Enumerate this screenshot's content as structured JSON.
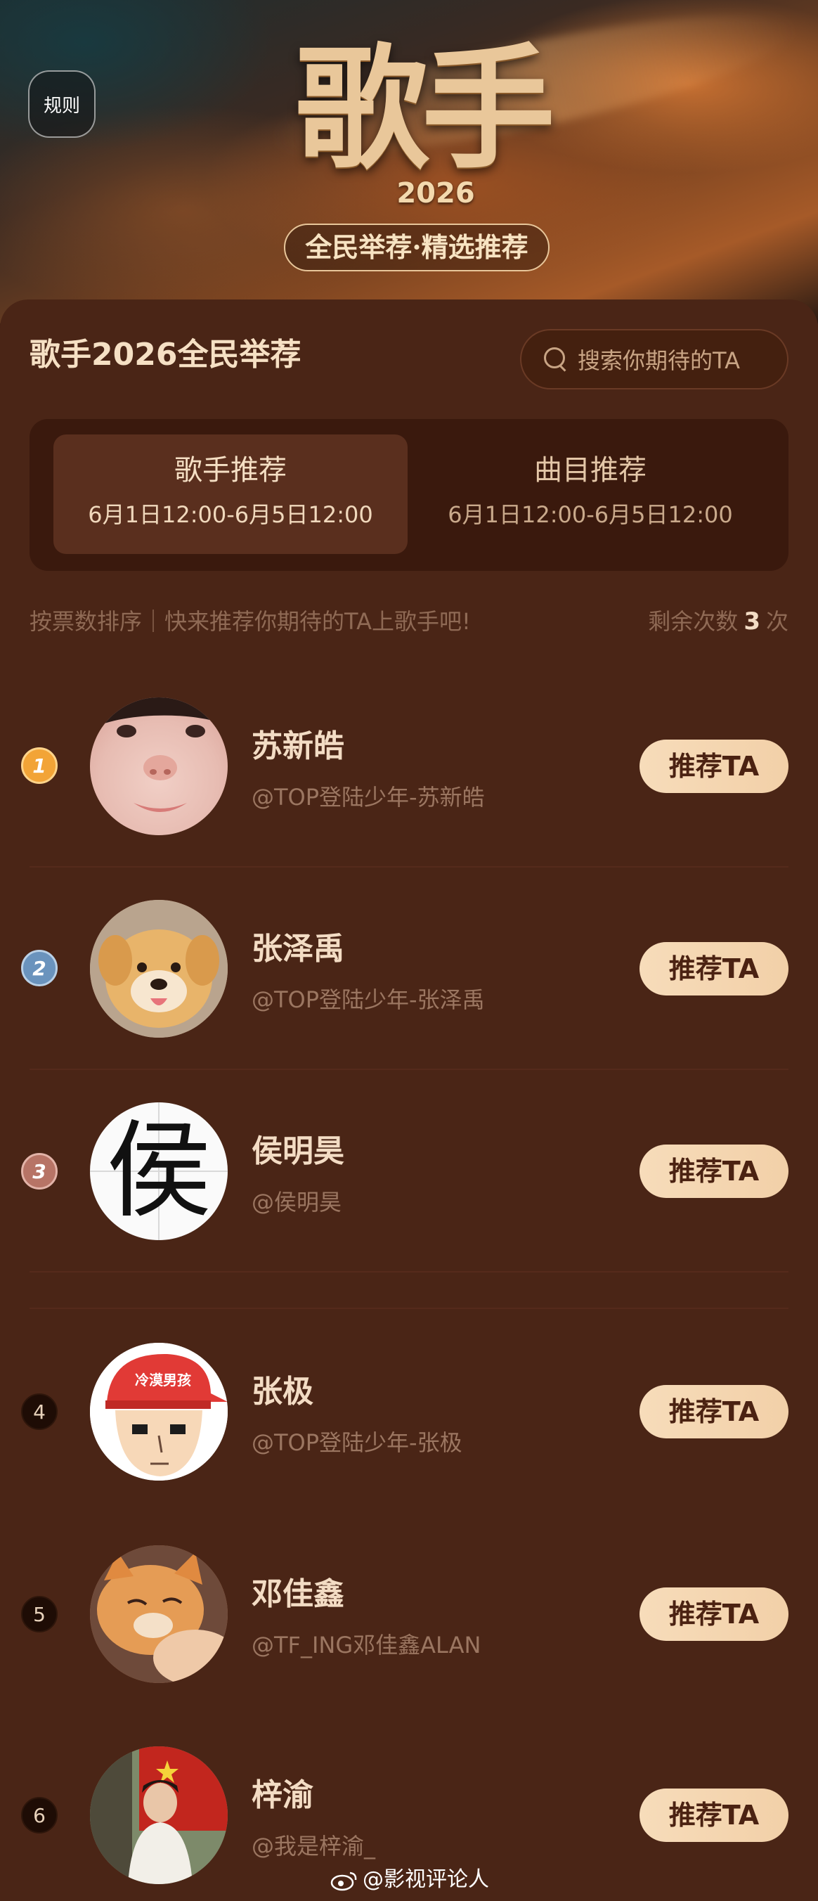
{
  "header": {
    "rules_label": "规则",
    "logo_text": "歌手",
    "logo_year": "2026",
    "logo_subtitle": "全民举荐·精选推荐"
  },
  "panel": {
    "title": "歌手2026全民举荐",
    "search_placeholder": "搜索你期待的TA"
  },
  "tabs": [
    {
      "label": "歌手推荐",
      "time": "6月1日12:00-6月5日12:00",
      "active": true
    },
    {
      "label": "曲目推荐",
      "time": "6月1日12:00-6月5日12:00",
      "active": false
    }
  ],
  "hint": "按票数排序｜快来推荐你期待的TA上歌手吧!",
  "remaining": {
    "prefix": "剩余次数",
    "count": "3",
    "suffix": "次"
  },
  "button_label": "推荐TA",
  "entries": [
    {
      "rank": "1",
      "name": "苏新皓",
      "handle": "@TOP登陆少年-苏新皓",
      "avatar": "face-closeup"
    },
    {
      "rank": "2",
      "name": "张泽禹",
      "handle": "@TOP登陆少年-张泽禹",
      "avatar": "puppy"
    },
    {
      "rank": "3",
      "name": "侯明昊",
      "handle": "@侯明昊",
      "avatar": "calligraphy-character",
      "avatar_text": "侯"
    },
    {
      "rank": "4",
      "name": "张极",
      "handle": "@TOP登陆少年-张极",
      "avatar": "cartoon-boy",
      "avatar_text": "冷漠男孩"
    },
    {
      "rank": "5",
      "name": "邓佳鑫",
      "handle": "@TF_ING邓佳鑫ALAN",
      "avatar": "cat"
    },
    {
      "rank": "6",
      "name": "梓渝",
      "handle": "@我是梓渝_",
      "avatar": "person-photo"
    }
  ],
  "watermark": "@影视评论人",
  "colors": {
    "background": "#3f2014",
    "panel": "#4a2516",
    "button": "#f7dcba",
    "rank1": "#f2a437",
    "rank2": "#6a93bd",
    "rank3": "#b77466"
  }
}
